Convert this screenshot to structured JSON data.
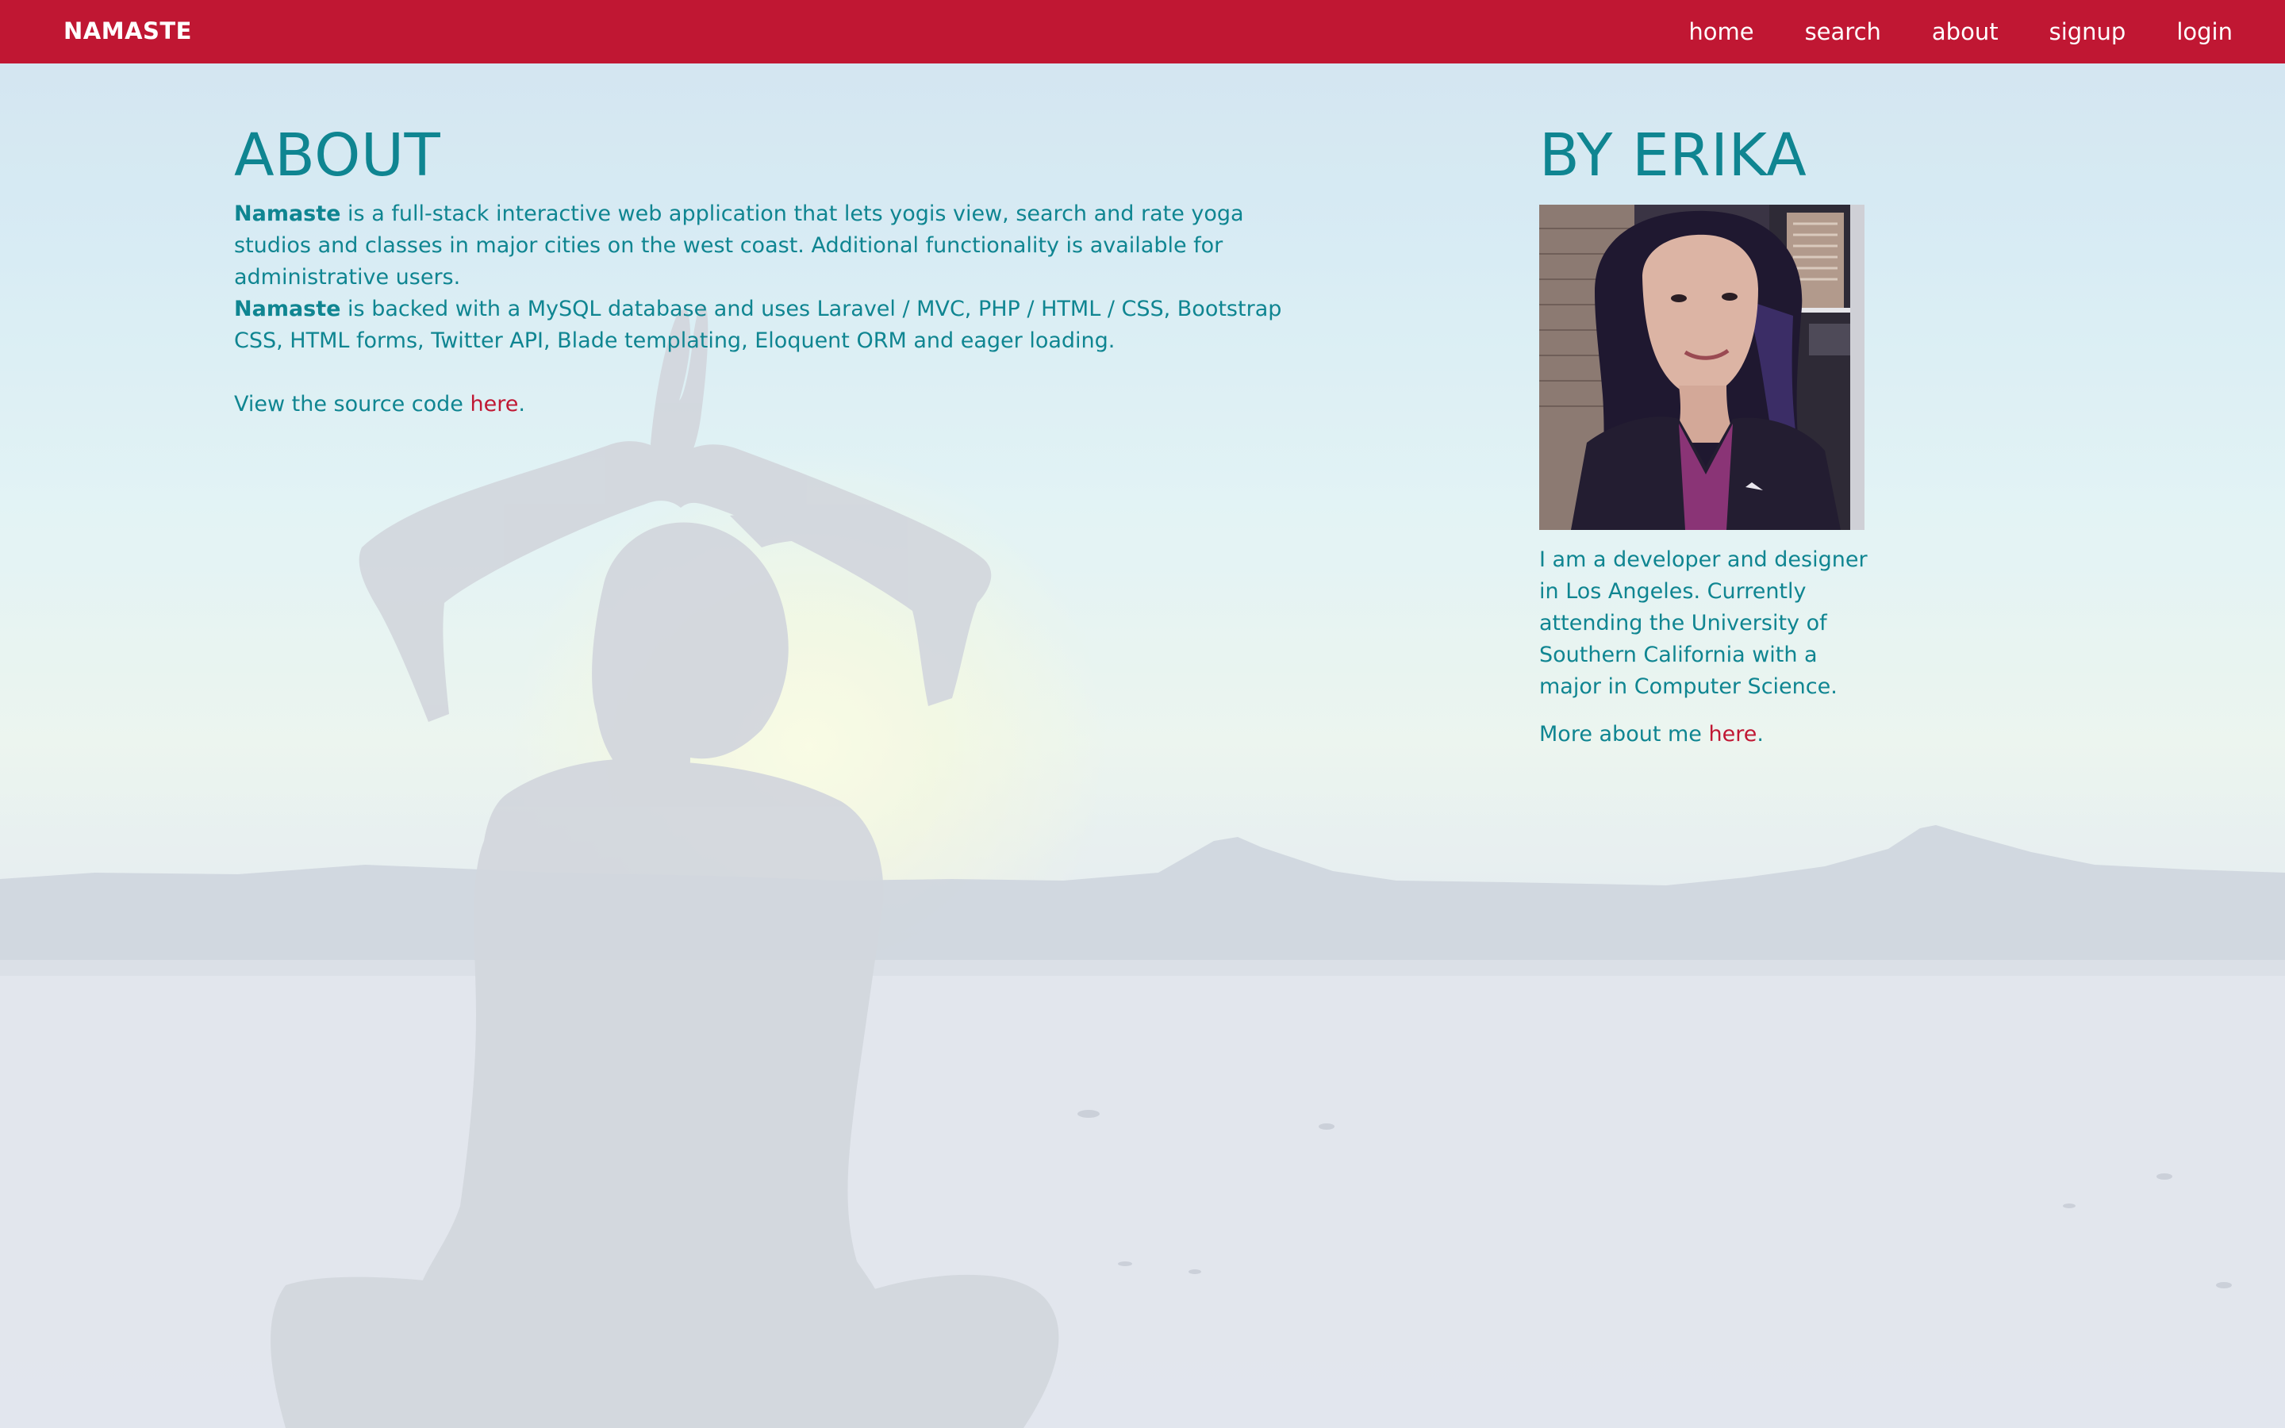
{
  "navbar": {
    "brand": "NAMASTE",
    "links": [
      "home",
      "search",
      "about",
      "signup",
      "login"
    ],
    "color": "#c01733"
  },
  "about": {
    "heading": "ABOUT",
    "p1_name": "Namaste",
    "p1_text": " is a full-stack interactive web application that lets yogis view, search and rate yoga studios and classes in major cities on the west coast. Additional functionality is available for administrative users.",
    "p2_name": "Namaste",
    "p2_text": " is backed with a MySQL database and uses Laravel / MVC, PHP / HTML / CSS, Bootstrap CSS, HTML forms, Twitter API, Blade templating, Eloquent ORM and eager loading.",
    "source_prefix": "View the source code ",
    "source_link": "here",
    "source_suffix": "."
  },
  "by": {
    "heading": "BY ERIKA",
    "bio": "I am a developer and designer in Los Angeles. Currently attending the University of Southern California with a major in Computer Science.",
    "more_prefix": "More about me ",
    "more_link": "here",
    "more_suffix": "."
  },
  "colors": {
    "accent": "#c01733",
    "text": "#0f8591"
  },
  "icons": {
    "background": "yoga-silhouette-background",
    "photo": "profile-photo"
  }
}
